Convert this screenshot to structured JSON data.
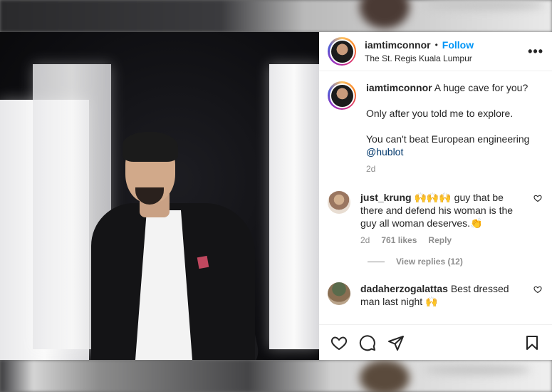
{
  "post": {
    "username": "iamtimconnor",
    "separator": "•",
    "follow_label": "Follow",
    "location": "The St. Regis Kuala Lumpur",
    "more_label": "•••"
  },
  "caption": {
    "username": "iamtimconnor",
    "line1": "A huge cave for you?",
    "line2": "Only after you told me to explore.",
    "line3": "You can't beat European engineering",
    "mention": "@hublot",
    "time": "2d"
  },
  "comments": [
    {
      "username": "just_krung",
      "text": "🙌🙌🙌 guy that be there and defend his woman is the guy all woman deserves.👏",
      "time": "2d",
      "likes": "761 likes",
      "reply_label": "Reply"
    },
    {
      "username": "dadaherzogalattas",
      "text": "Best dressed man last night 🙌"
    }
  ],
  "view_replies": "View replies (12)",
  "icons": {
    "like": "heart-icon",
    "comment": "comment-icon",
    "share": "paper-plane-icon",
    "save": "bookmark-icon",
    "more": "more-icon"
  },
  "colors": {
    "accent": "#0095f6",
    "text": "#262626",
    "muted": "#8e8e8e",
    "mention": "#00376b"
  }
}
